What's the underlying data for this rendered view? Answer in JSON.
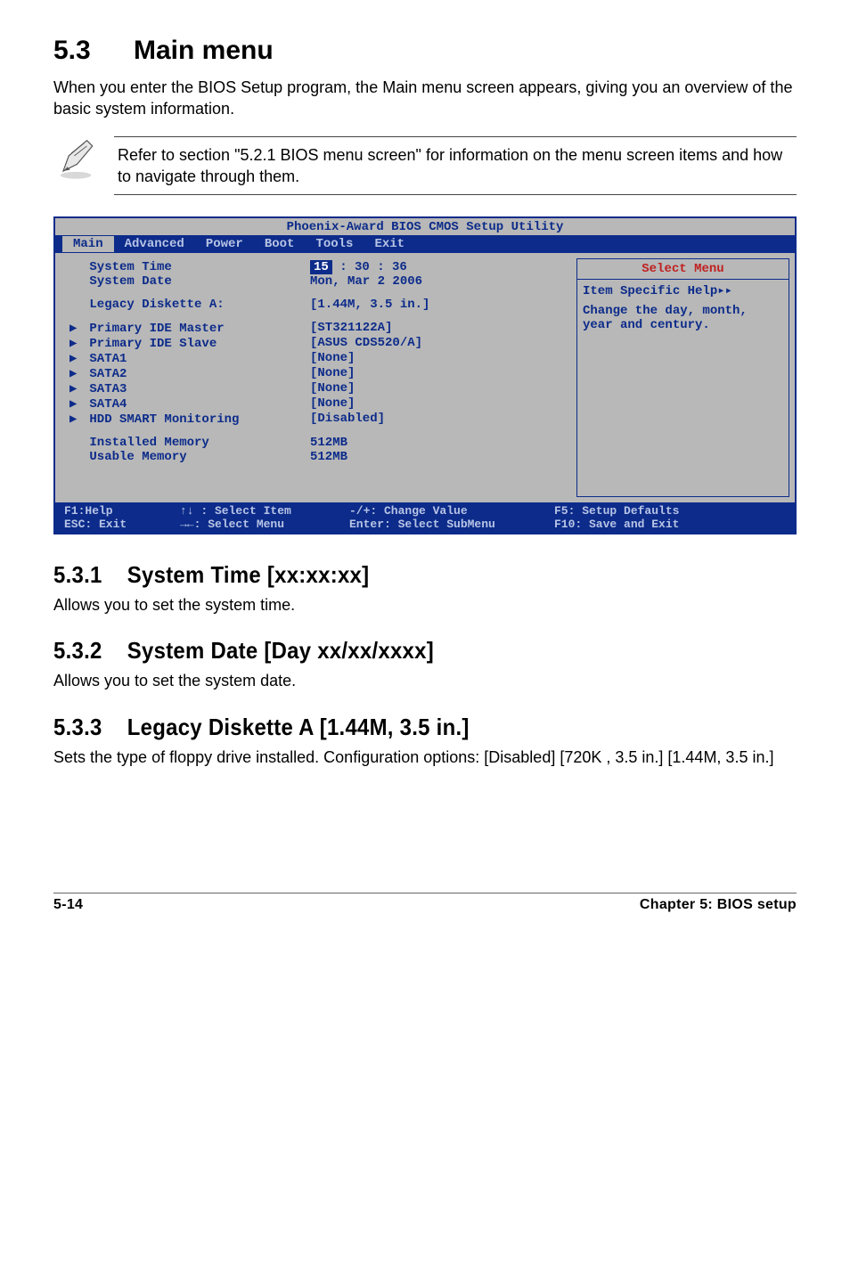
{
  "section": {
    "number": "5.3",
    "title": "Main menu",
    "intro": "When you enter the BIOS Setup program, the Main menu screen appears, giving you an overview of the basic system information.",
    "note": "Refer to section \"5.2.1  BIOS menu screen\" for information on the menu screen items and how to navigate through them."
  },
  "bios": {
    "utility_title": "Phoenix-Award BIOS CMOS Setup Utility",
    "tabs": [
      "Main",
      "Advanced",
      "Power",
      "Boot",
      "Tools",
      "Exit"
    ],
    "active_tab": "Main",
    "rows": [
      {
        "label": "System Time",
        "value_prefix_boxed": "15",
        "value_rest": " : 30 : 36"
      },
      {
        "label": "System Date",
        "value": "Mon, Mar 2  2006"
      },
      {
        "spacer": true
      },
      {
        "label": "Legacy Diskette A:",
        "value": "[1.44M, 3.5 in.]"
      },
      {
        "spacer": true
      },
      {
        "arrow": true,
        "label": "Primary IDE Master",
        "value": "[ST321122A]"
      },
      {
        "arrow": true,
        "label": "Primary IDE Slave",
        "value": "[ASUS CDS520/A]"
      },
      {
        "arrow": true,
        "label": "SATA1",
        "value": "[None]"
      },
      {
        "arrow": true,
        "label": "SATA2",
        "value": "[None]"
      },
      {
        "arrow": true,
        "label": "SATA3",
        "value": "[None]"
      },
      {
        "arrow": true,
        "label": "SATA4",
        "value": "[None]"
      },
      {
        "arrow": true,
        "label": "HDD SMART Monitoring",
        "value": "[Disabled]"
      },
      {
        "spacer": true
      },
      {
        "label": "Installed Memory",
        "value": "512MB"
      },
      {
        "label": "Usable Memory",
        "value": "512MB"
      }
    ],
    "help": {
      "title": "Select Menu",
      "item_specific": "Item Specific Help▸▸",
      "text": "Change the day, month, year and century."
    },
    "footer": {
      "c1a": "F1:Help",
      "c1b": "ESC: Exit",
      "c2a": "↑↓ : Select Item",
      "c2b": "→←: Select Menu",
      "c3a": "-/+: Change Value",
      "c3b": "Enter: Select SubMenu",
      "c4a": "F5: Setup Defaults",
      "c4b": "F10: Save and Exit"
    }
  },
  "subs": [
    {
      "num": "5.3.1",
      "title": "System Time [xx:xx:xx]",
      "body": "Allows you to set the system time."
    },
    {
      "num": "5.3.2",
      "title": "System Date [Day xx/xx/xxxx]",
      "body": "Allows you to set the system date."
    },
    {
      "num": "5.3.3",
      "title": "Legacy Diskette A [1.44M, 3.5 in.]",
      "body": "Sets the type of floppy drive installed. Configuration options: [Disabled] [720K , 3.5 in.] [1.44M, 3.5 in.]"
    }
  ],
  "footer": {
    "left": "5-14",
    "right": "Chapter 5: BIOS setup"
  }
}
